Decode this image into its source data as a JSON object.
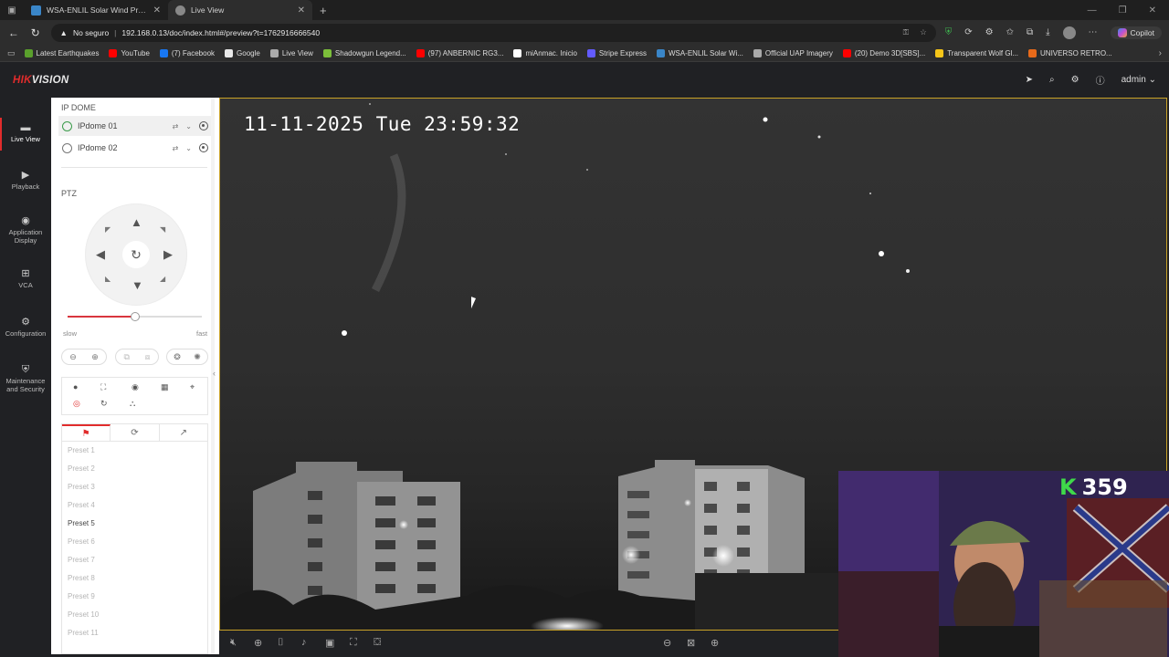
{
  "browser": {
    "tabs": [
      {
        "title": "WSA-ENLIL Solar Wind Prediction"
      },
      {
        "title": "Live View"
      }
    ],
    "address": {
      "security_label": "No seguro",
      "url": "192.168.0.13/doc/index.html#/preview?t=1762916666540"
    },
    "copilot_label": "Copilot",
    "bookmarks": [
      {
        "label": "Latest Earthquakes",
        "color": "#5aa02c"
      },
      {
        "label": "YouTube",
        "color": "#ff0000"
      },
      {
        "label": "(7) Facebook",
        "color": "#1877f2"
      },
      {
        "label": "Google",
        "color": "#e8e8e8"
      },
      {
        "label": "Live View",
        "color": "#aaaaaa"
      },
      {
        "label": "Shadowgun Legend...",
        "color": "#7cbf3a"
      },
      {
        "label": "(97) ANBERNIC RG3...",
        "color": "#ff0000"
      },
      {
        "label": "miAnmac. Inicio",
        "color": "#ffffff"
      },
      {
        "label": "Stripe Express",
        "color": "#635bff"
      },
      {
        "label": "WSA-ENLIL Solar Wi...",
        "color": "#3a86c8"
      },
      {
        "label": "Official UAP Imagery",
        "color": "#aaaaaa"
      },
      {
        "label": "(20) Demo 3D[SBS]...",
        "color": "#ff0000"
      },
      {
        "label": "Transparent Wolf Gl...",
        "color": "#f5c518"
      },
      {
        "label": "UNIVERSO RETRO...",
        "color": "#e86a1a"
      }
    ]
  },
  "header": {
    "logo_red": "HIK",
    "logo_white": "VISION",
    "user": "admin"
  },
  "nav": [
    {
      "label": "Live View",
      "icon": "live-view-icon"
    },
    {
      "label": "Playback",
      "icon": "playback-icon"
    },
    {
      "label": "Application Display",
      "icon": "application-icon"
    },
    {
      "label": "VCA",
      "icon": "vca-icon"
    },
    {
      "label": "Configuration",
      "icon": "gear-icon"
    },
    {
      "label": "Maintenance and Security",
      "icon": "maintenance-icon"
    }
  ],
  "panel": {
    "group_title": "IP DOME",
    "cameras": [
      {
        "name": "IPdome 01",
        "selected": true
      },
      {
        "name": "IPdome 02",
        "selected": false
      }
    ],
    "ptz_title": "PTZ",
    "speed": {
      "slow_label": "slow",
      "fast_label": "fast",
      "value": 0.5
    },
    "presets": [
      {
        "label": "Preset 1",
        "active": false
      },
      {
        "label": "Preset 2",
        "active": false
      },
      {
        "label": "Preset 3",
        "active": false
      },
      {
        "label": "Preset 4",
        "active": false
      },
      {
        "label": "Preset 5",
        "active": true
      },
      {
        "label": "Preset 6",
        "active": false
      },
      {
        "label": "Preset 7",
        "active": false
      },
      {
        "label": "Preset 8",
        "active": false
      },
      {
        "label": "Preset 9",
        "active": false
      },
      {
        "label": "Preset 10",
        "active": false
      },
      {
        "label": "Preset 11",
        "active": false
      }
    ]
  },
  "video": {
    "osd_timestamp": "11-11-2025 Tue 23:59:32"
  },
  "overlay": {
    "badge_letter": "K",
    "badge_number": "359"
  }
}
